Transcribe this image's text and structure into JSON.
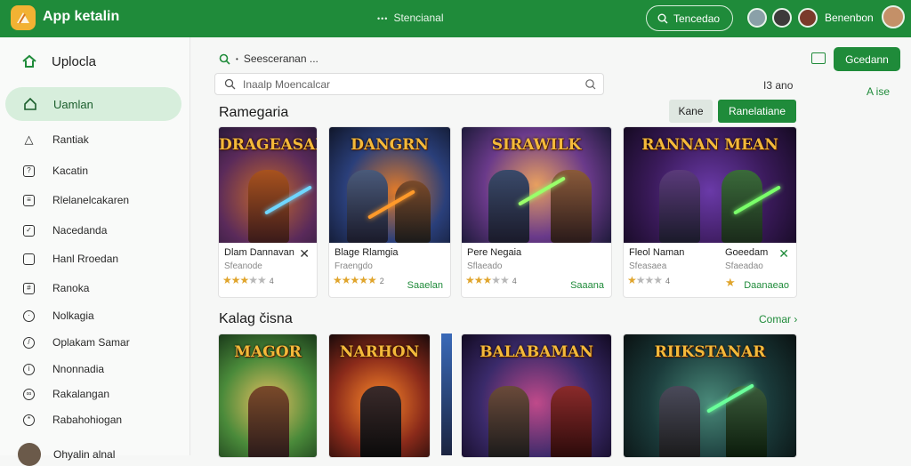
{
  "header": {
    "app_title": "App ketalin",
    "center_dots": "•••",
    "center_label": "Stencianal",
    "search_label": "Tencedao",
    "user_name": "Benenbon"
  },
  "sidebar": {
    "heading": "Uplocla",
    "active_item": "Uamlan",
    "items": [
      {
        "label": "Rantiak",
        "icon": "warning-icon"
      },
      {
        "label": "Kacatin",
        "icon": "help-icon"
      },
      {
        "label": "Rlelanelcakaren",
        "icon": "document-icon"
      },
      {
        "label": "Nacedanda",
        "icon": "check-icon"
      },
      {
        "label": "Hanl Rroedan",
        "icon": "square-icon"
      },
      {
        "label": "Ranoka",
        "icon": "grid-icon"
      },
      {
        "label": "Nolkagia",
        "icon": "clock-icon"
      },
      {
        "label": "Oplakam Samar",
        "icon": "compass-icon"
      },
      {
        "label": "Nnonnadia",
        "icon": "info-icon"
      },
      {
        "label": "Rakalangan",
        "icon": "link-icon"
      },
      {
        "label": "Rabahohiogan",
        "icon": "settings-icon"
      }
    ],
    "footer_label": "Ohyalin alnal"
  },
  "toolbar": {
    "breadcrumb": "Seesceranan ...",
    "search_placeholder": "Inaalp Moencalcar",
    "filter_count": "I3 ano",
    "action_button": "Gcedann",
    "sort_link": "A ise",
    "btn_light": "Kane",
    "btn_green": "Ranelatiane"
  },
  "sections": [
    {
      "title": "Ramegaria",
      "cards": [
        {
          "thumb_title": "DRAGEASAN",
          "name": "Dlam Dannavan",
          "sub": "Sfeanode",
          "stars": 3,
          "rating": "4",
          "price": "",
          "xmark": "✕"
        },
        {
          "thumb_title": "DANGRN",
          "name": "Blage Rlamgia",
          "sub": "Fraengdo",
          "stars": 5,
          "rating": "2",
          "price": "Saaelan",
          "xmark": ""
        },
        {
          "thumb_title": "SIRAWILK",
          "name": "Pere Negaia",
          "sub": "Sflaeado",
          "stars": 3,
          "rating": "4",
          "price": "Saaana",
          "xmark": ""
        },
        {
          "thumb_title": "RANNAN MEAN",
          "name": "Fleol Naman",
          "sub": "Sfeasaea",
          "stars": 1,
          "rating": "4",
          "price": "",
          "xmark": ""
        },
        {
          "thumb_title": "",
          "name": "Goeedam",
          "sub": "Sfaeadao",
          "stars": 1,
          "rating": "",
          "price": "Daanaeao",
          "xmark": "✕"
        }
      ]
    },
    {
      "title": "Kalag čisna",
      "see_more": "Comar ›",
      "cards": [
        {
          "thumb_title": "MAGOR"
        },
        {
          "thumb_title": "NARHON"
        },
        {
          "thumb_title": "BALABAMAN"
        },
        {
          "thumb_title": "RIIKSTANAR"
        }
      ]
    }
  ],
  "colors": {
    "brand_green": "#1f8b3a",
    "active_bg": "#d7eedc",
    "star": "#e0a52d"
  }
}
